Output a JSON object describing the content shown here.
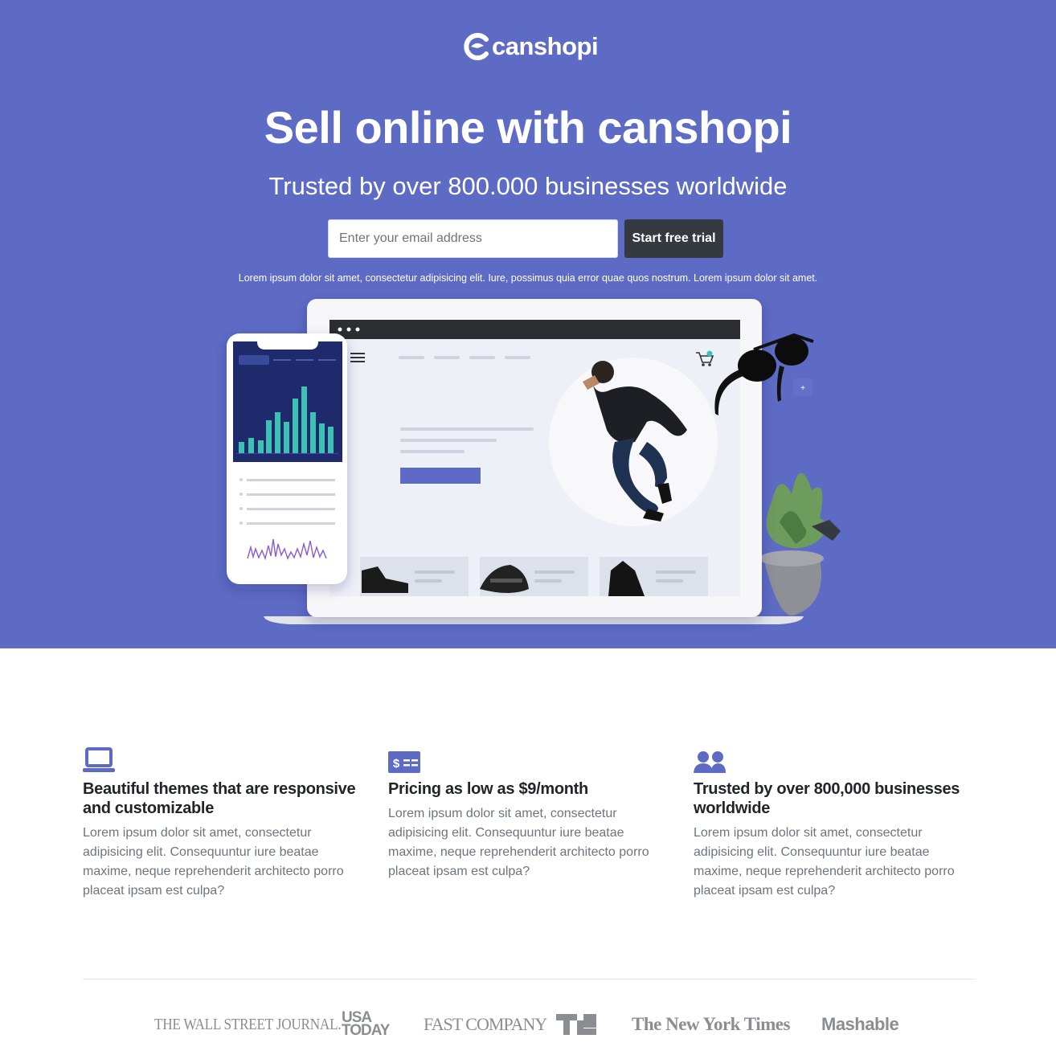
{
  "brand": {
    "name": "canshopi",
    "color": "#5d6bc4",
    "icon": "canshopi-logo-icon"
  },
  "hero": {
    "title": "Sell online with canshopi",
    "subtitle": "Trusted by over 800.000 businesses worldwide",
    "email_placeholder": "Enter your email address",
    "cta_label": "Start free trial",
    "note": "Lorem ipsum dolor sit amet, consectetur adipisicing elit. Iure, possimus quia error quae quos nostrum. Lorem ipsum dolor sit amet."
  },
  "features": [
    {
      "icon": "laptop-icon",
      "title": "Beautiful themes that are responsive and customizable",
      "text": "Lorem ipsum dolor sit amet, consectetur adipisicing elit. Consequuntur iure beatae maxime, neque reprehenderit architecto porro placeat ipsam est culpa?"
    },
    {
      "icon": "money-bill-icon",
      "title": "Pricing as low as $9/month",
      "text": "Lorem ipsum dolor sit amet, consectetur adipisicing elit. Consequuntur iure beatae maxime, neque reprehenderit architecto porro placeat ipsam est culpa?"
    },
    {
      "icon": "users-icon",
      "title": "Trusted by over 800,000 businesses worldwide",
      "text": "Lorem ipsum dolor sit amet, consectetur adipisicing elit. Consequuntur iure beatae maxime, neque reprehenderit architecto porro placeat ipsam est culpa?"
    }
  ],
  "press": {
    "wsj": "THE WALL STREET JOURNAL.",
    "usa_today_1": "USA",
    "usa_today_2": "TODAY",
    "fast_company": "FAST COMPANY",
    "techcrunch": "TC",
    "nyt": "The New York Times",
    "mashable": "Mashable"
  },
  "colors": {
    "accent": "#5d6bc4",
    "dark_button": "#343a40",
    "chart_teal": "#3ec1b5",
    "text_muted": "#6c757d"
  }
}
